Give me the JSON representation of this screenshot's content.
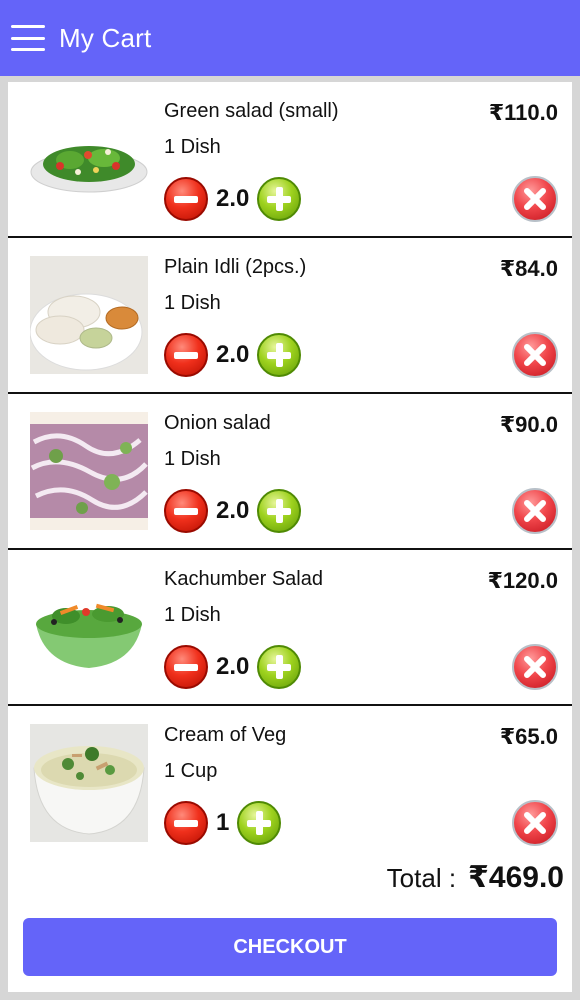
{
  "appbar": {
    "title": "My Cart",
    "color": "#6464f9"
  },
  "items": [
    {
      "name": "Green salad (small)",
      "unit": "1 Dish",
      "price": "₹110.0",
      "qty": "2.0",
      "image": "green-salad-image"
    },
    {
      "name": "Plain Idli (2pcs.)",
      "unit": "1 Dish",
      "price": "₹84.0",
      "qty": "2.0",
      "image": "idli-image"
    },
    {
      "name": "Onion salad",
      "unit": "1 Dish",
      "price": "₹90.0",
      "qty": "2.0",
      "image": "onion-salad-image"
    },
    {
      "name": "Kachumber Salad",
      "unit": "1 Dish",
      "price": "₹120.0",
      "qty": "2.0",
      "image": "kachumber-salad-image"
    },
    {
      "name": "Cream of Veg",
      "unit": "1 Cup",
      "price": "₹65.0",
      "qty": "1",
      "image": "veg-soup-image"
    }
  ],
  "total": {
    "label": "Total :",
    "value": "₹469.0"
  },
  "checkout": {
    "label": "CHECKOUT"
  },
  "icons": {
    "menu": "hamburger-icon",
    "minus": "minus-icon",
    "plus": "plus-icon",
    "remove": "remove-icon"
  }
}
